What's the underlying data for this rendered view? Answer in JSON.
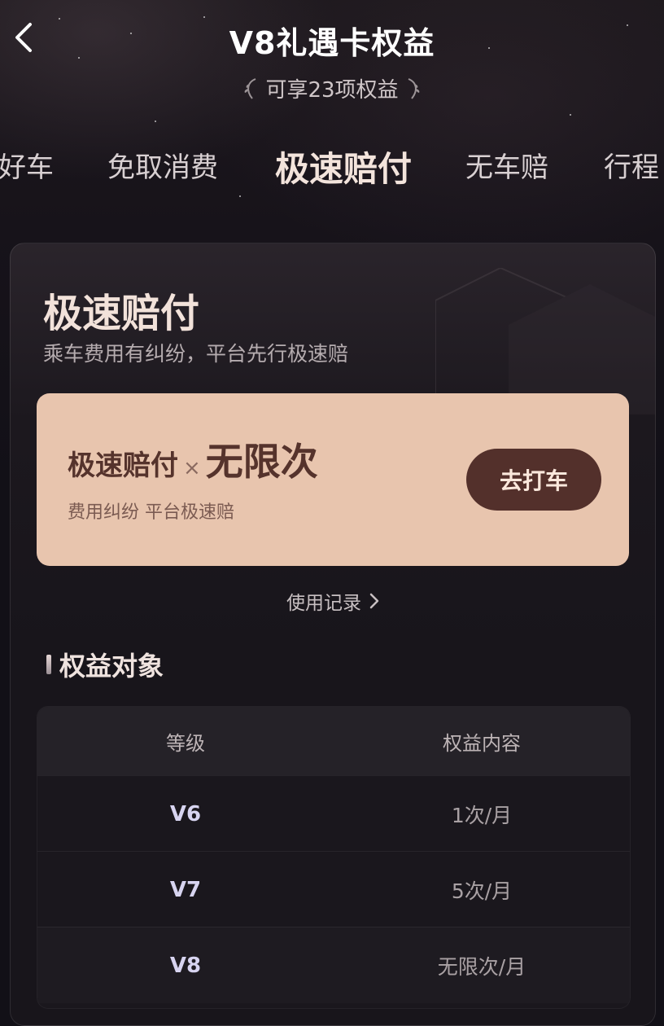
{
  "header": {
    "title": "V8礼遇卡权益",
    "subtitle": "可享23项权益",
    "back_icon": "chevron-left-icon"
  },
  "tabs": [
    {
      "label": "好车",
      "active": false
    },
    {
      "label": "免取消费",
      "active": false
    },
    {
      "label": "极速赔付",
      "active": true
    },
    {
      "label": "无车赔",
      "active": false
    },
    {
      "label": "行程",
      "active": false
    }
  ],
  "card": {
    "title": "极速赔付",
    "description": "乘车费用有纠纷，平台先行极速赔",
    "benefit": {
      "name": "极速赔付",
      "times_symbol": "×",
      "count": "无限次",
      "note": "费用纠纷 平台极速赔",
      "button_label": "去打车"
    },
    "usage_link": "使用记录"
  },
  "section": {
    "title": "权益对象"
  },
  "table": {
    "headers": [
      "等级",
      "权益内容"
    ],
    "rows": [
      {
        "level": "V6",
        "value": "1次/月"
      },
      {
        "level": "V7",
        "value": "5次/月"
      },
      {
        "level": "V8",
        "value": "无限次/月"
      }
    ]
  },
  "colors": {
    "background": "#121017",
    "benefit_box": "#e8c5ae",
    "button": "#53302b",
    "accent_text": "#f2e2da",
    "level_text": "#d7d4f0"
  }
}
